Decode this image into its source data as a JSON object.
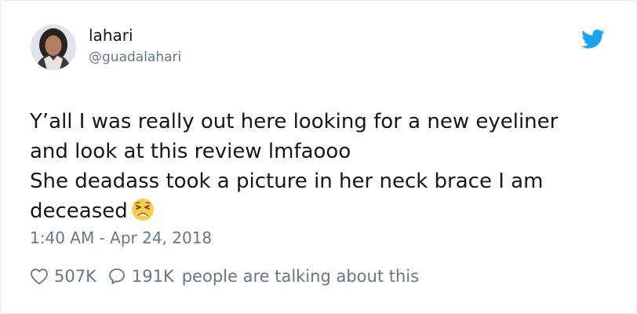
{
  "tweet": {
    "author": {
      "display_name": "lahari",
      "handle": "@guadalahari"
    },
    "lines": [
      "Y’all I was really out here looking for a new eyeliner",
      "and look at this review lmfaooo",
      "She deadass took a picture in her neck brace I am",
      "deceased"
    ],
    "emoji": "weary-face-emoji",
    "timestamp": "1:40 AM - Apr 24, 2018",
    "likes": "507K",
    "replies": "191K",
    "talking_text": "people are talking about this"
  },
  "colors": {
    "brand": "#1da1f2",
    "secondary_text": "#657786",
    "primary_text": "#14171a"
  },
  "icons": [
    "twitter-bird-icon",
    "heart-icon",
    "reply-bubble-icon"
  ]
}
